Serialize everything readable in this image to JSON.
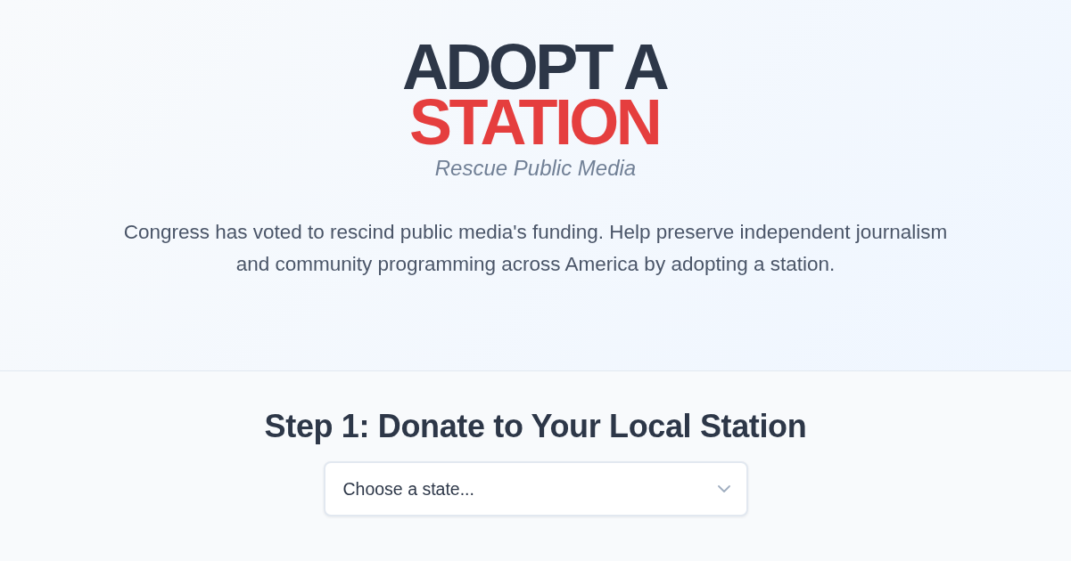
{
  "hero": {
    "logo": {
      "line_1": "ADOPT A",
      "line_2": "STATION"
    },
    "tagline": "Rescue Public Media",
    "intro": "Congress has voted to rescind public media's funding. Help preserve independent journalism and community programming across America by adopting a station."
  },
  "step": {
    "heading": "Step 1: Donate to Your Local Station",
    "state_select": {
      "placeholder": "Choose a state..."
    }
  }
}
